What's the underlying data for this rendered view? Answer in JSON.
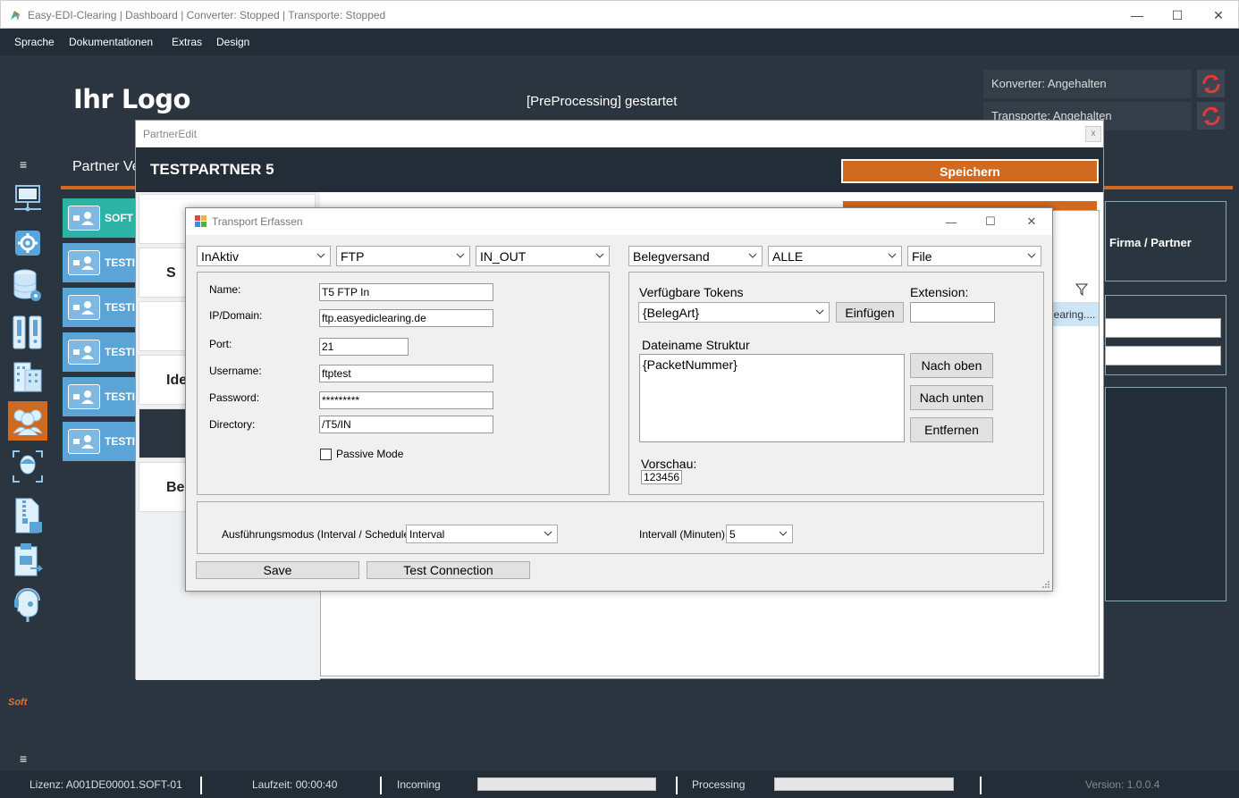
{
  "window": {
    "title": "Easy-EDI-Clearing | Dashboard | Converter: Stopped | Transporte: Stopped",
    "minimize": "—",
    "maximize": "☐",
    "close": "✕"
  },
  "menu": [
    "Sprache",
    "Dokumentationen",
    "Extras",
    "Design"
  ],
  "header": {
    "logo": "Ihr Logo",
    "message": "[PreProcessing] gestartet",
    "converter_status": "Konverter: Angehalten",
    "transport_status": "Transporte: Angehalten"
  },
  "sidebar": {
    "menu_glyph": "≡",
    "icons": [
      "monitor-network-icon",
      "gear-icon",
      "database-gear-icon",
      "binder-icon",
      "building-icon",
      "users-icon",
      "face-scan-icon",
      "zip-file-icon",
      "clipboard-transfer-icon",
      "head-support-icon"
    ],
    "active_index": 5,
    "brand": "Soft"
  },
  "partner_list": {
    "title": "Partner Ve",
    "items": [
      "SOFT",
      "TESTI",
      "TESTI",
      "TESTI",
      "TESTI",
      "TESTI"
    ],
    "selected_index": 0
  },
  "right_panel": {
    "label": "Firma / Partner"
  },
  "partner_edit": {
    "title": "PartnerEdit",
    "close": "x",
    "partner_name": "TESTPARTNER 5",
    "save_label": "Speichern",
    "tabs": [
      "",
      "S",
      "",
      "Ide",
      "",
      "Bel"
    ],
    "grid_row": "learing...."
  },
  "transport": {
    "title": "Transport Erfassen",
    "status": "InAktiv",
    "protocol": "FTP",
    "direction": "IN_OUT",
    "doc_type": "Belegversand",
    "scope": "ALLE",
    "target": "File",
    "fields": {
      "name_label": "Name:",
      "name_value": "T5 FTP In",
      "ip_label": "IP/Domain:",
      "ip_value": "ftp.easyediclearing.de",
      "port_label": "Port:",
      "port_value": "21",
      "username_label": "Username:",
      "username_value": "ftptest",
      "password_label": "Password:",
      "password_value": "*********",
      "directory_label": "Directory:",
      "directory_value": "/T5/IN",
      "passive_label": "Passive Mode",
      "passive_checked": false
    },
    "tokens": {
      "label": "Verfügbare Tokens",
      "selected": "{BelegArt}",
      "insert_label": "Einfügen",
      "extension_label": "Extension:",
      "extension_value": "",
      "structure_label": "Dateiname Struktur",
      "structure_value": "{PacketNummer}",
      "up_label": "Nach oben",
      "down_label": "Nach unten",
      "remove_label": "Entfernen",
      "preview_label": "Vorschau:",
      "preview_value": "123456"
    },
    "mode_label": "Ausführungsmodus (Interval / Scheduler):",
    "mode_value": "Interval",
    "interval_label": "Intervall (Minuten):",
    "interval_value": "5",
    "save_label": "Save",
    "test_label": "Test Connection"
  },
  "statusbar": {
    "license": "Lizenz: A001DE00001.SOFT-01",
    "runtime": "Laufzeit: 00:00:40",
    "incoming": "Incoming",
    "processing": "Processing",
    "incoming_progress": 0,
    "processing_progress": 0,
    "version": "Version: 1.0.0.4"
  },
  "colors": {
    "accent": "#d06a21",
    "background": "#2b3540",
    "bar": "#232d37",
    "list_item": "#5aa4d8",
    "list_item_selected": "#2cb3a6",
    "refresh": "#e03a3a"
  }
}
